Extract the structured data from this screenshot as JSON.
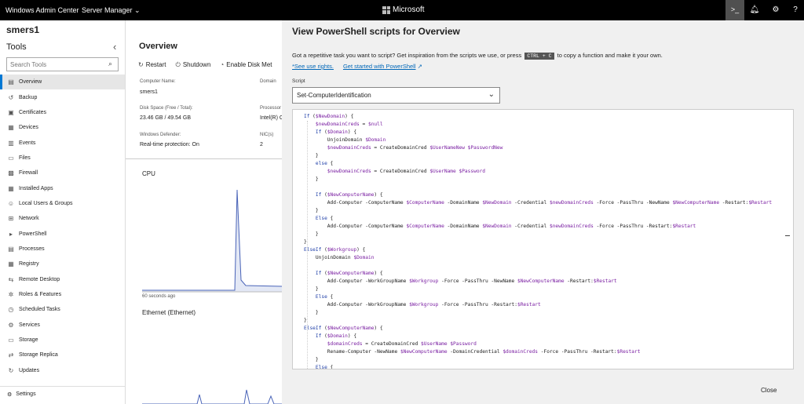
{
  "topbar": {
    "app_title": "Windows Admin Center",
    "server_manager": "Server Manager",
    "brand": "Microsoft",
    "ps_icon": "powershell-icon",
    "bell_icon": "notification-bell-icon",
    "gear_icon": "gear-icon",
    "help_icon": "help-icon"
  },
  "server_name": "smers1",
  "tools": {
    "heading": "Tools",
    "search_placeholder": "Search Tools",
    "items": [
      {
        "label": "Overview",
        "icon": "overview-icon",
        "active": true
      },
      {
        "label": "Backup",
        "icon": "backup-icon"
      },
      {
        "label": "Certificates",
        "icon": "certificates-icon"
      },
      {
        "label": "Devices",
        "icon": "devices-icon"
      },
      {
        "label": "Events",
        "icon": "events-icon"
      },
      {
        "label": "Files",
        "icon": "files-icon"
      },
      {
        "label": "Firewall",
        "icon": "firewall-icon"
      },
      {
        "label": "Installed Apps",
        "icon": "installed-apps-icon"
      },
      {
        "label": "Local Users & Groups",
        "icon": "users-icon"
      },
      {
        "label": "Network",
        "icon": "network-icon"
      },
      {
        "label": "PowerShell",
        "icon": "powershell-icon"
      },
      {
        "label": "Processes",
        "icon": "processes-icon"
      },
      {
        "label": "Registry",
        "icon": "registry-icon"
      },
      {
        "label": "Remote Desktop",
        "icon": "remote-desktop-icon"
      },
      {
        "label": "Roles & Features",
        "icon": "roles-icon"
      },
      {
        "label": "Scheduled Tasks",
        "icon": "scheduled-tasks-icon"
      },
      {
        "label": "Services",
        "icon": "services-icon"
      },
      {
        "label": "Storage",
        "icon": "storage-icon"
      },
      {
        "label": "Storage Replica",
        "icon": "storage-replica-icon"
      },
      {
        "label": "Updates",
        "icon": "updates-icon"
      }
    ],
    "settings_label": "Settings"
  },
  "overview": {
    "title": "Overview",
    "actions": [
      "Restart",
      "Shutdown",
      "Enable Disk Met"
    ],
    "props": {
      "computer_name_label": "Computer Name:",
      "computer_name": "smers1",
      "domain_label": "Domain",
      "disk_label": "Disk Space (Free / Total):",
      "disk_value": "23.46 GB / 49.54 GB",
      "processor_label": "Processor",
      "processor_value": "Intel(R) C",
      "defender_label": "Windows Defender:",
      "defender_value": "Real-time protection: On",
      "nics_label": "NIC(s)",
      "nics_value": "2"
    },
    "cpu_label": "CPU",
    "seconds_ago": "60 seconds ago",
    "ethernet_label": "Ethernet (Ethernet)"
  },
  "panel": {
    "title": "View PowerShell scripts for Overview",
    "intro_before": "Got a repetitive task you want to script? Get inspiration from the scripts we use, or press",
    "intro_key": "CTRL + C",
    "intro_after": "to copy a function and make it your own.",
    "link_rights": "*See use rights.",
    "link_started": "Get started with PowerShell",
    "script_label": "Script",
    "script_selected": "Set-ComputerIdentification",
    "close_label": "Close",
    "code_lines": [
      "If ($NewDomain) {",
      "    $newDomainCreds = $null",
      "    If ($Domain) {",
      "        UnjoinDomain $Domain",
      "        $newDomainCreds = CreateDomainCred $UserNameNew $PasswordNew",
      "    }",
      "    else {",
      "        $newDomainCreds = CreateDomainCred $UserName $Password",
      "    }",
      "",
      "    If ($NewComputerName) {",
      "        Add-Computer -ComputerName $ComputerName -DomainName $NewDomain -Credential $newDomainCreds -Force -PassThru -NewName $NewComputerName -Restart:$Restart",
      "    }",
      "    Else {",
      "        Add-Computer -ComputerName $ComputerName -DomainName $NewDomain -Credential $newDomainCreds -Force -PassThru -Restart:$Restart",
      "    }",
      "}",
      "ElseIf ($Workgroup) {",
      "    UnjoinDomain $Domain",
      "",
      "    If ($NewComputerName) {",
      "        Add-Computer -WorkGroupName $Workgroup -Force -PassThru -NewName $NewComputerName -Restart:$Restart",
      "    }",
      "    Else {",
      "        Add-Computer -WorkGroupName $Workgroup -Force -PassThru -Restart:$Restart",
      "    }",
      "}",
      "ElseIf ($NewComputerName) {",
      "    If ($Domain) {",
      "        $domainCreds = CreateDomainCred $UserName $Password",
      "        Rename-Computer -NewName $NewComputerName -DomainCredential $domainCreds -Force -PassThru -Restart:$Restart",
      "    }",
      "    Else {"
    ]
  }
}
